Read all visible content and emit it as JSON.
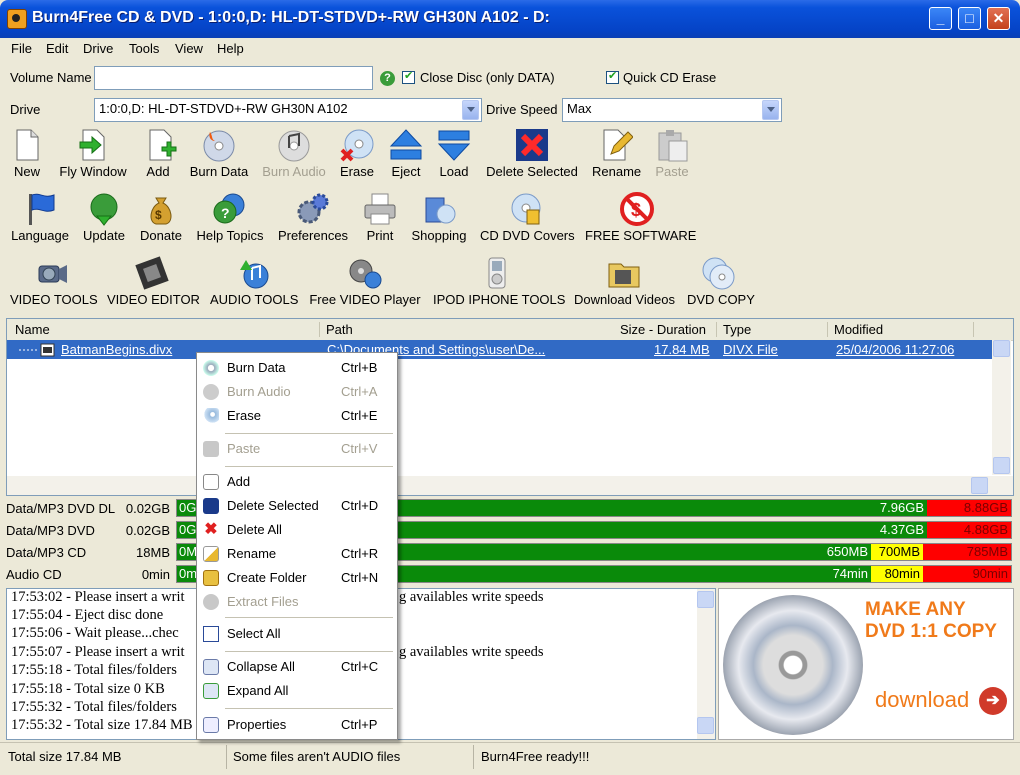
{
  "window": {
    "title": "Burn4Free CD & DVD - 1:0:0,D: HL-DT-STDVD+-RW GH30N   A102 - D:",
    "min": "_",
    "max": "□",
    "close": "✕"
  },
  "menu": [
    "File",
    "Edit",
    "Drive",
    "Tools",
    "View",
    "Help"
  ],
  "form": {
    "volume_label": "Volume Name",
    "volume_value": "",
    "close_disc": "Close Disc (only DATA)",
    "quick_erase": "Quick CD Erase",
    "drive_label": "Drive",
    "drive_value": "1:0:0,D: HL-DT-STDVD+-RW GH30N   A102",
    "speed_label": "Drive Speed",
    "speed_value": "Max"
  },
  "toolbar1": [
    "New",
    "Fly Window",
    "Add",
    "Burn Data",
    "Burn Audio",
    "Erase",
    "Eject",
    "Load",
    "Delete Selected",
    "Rename",
    "Paste"
  ],
  "toolbar2": [
    "Language",
    "Update",
    "Donate",
    "Help Topics",
    "Preferences",
    "Print",
    "Shopping",
    "CD DVD Covers",
    "FREE SOFTWARE"
  ],
  "toolbar3": [
    "VIDEO TOOLS",
    "VIDEO EDITOR",
    "AUDIO TOOLS",
    "Free VIDEO Player",
    "IPOD IPHONE TOOLS",
    "Download Videos",
    "DVD COPY"
  ],
  "list": {
    "headers": [
      "Name",
      "Path",
      "Size - Duration",
      "Type",
      "Modified"
    ],
    "row": {
      "name": "BatmanBegins.divx",
      "path": "C:\\Documents and Settings\\user\\De...",
      "size": "17.84 MB",
      "type": "DIVX File",
      "modified": "25/04/2006 11:27:06"
    }
  },
  "capacity": [
    {
      "name": "Data/MP3 DVD DL",
      "size": "0.02GB",
      "start": "0G",
      "mid": "",
      "good": "7.96GB",
      "max": "8.88GB"
    },
    {
      "name": "Data/MP3 DVD",
      "size": "0.02GB",
      "start": "0G",
      "mid": "",
      "good": "4.37GB",
      "max": "4.88GB"
    },
    {
      "name": "Data/MP3 CD",
      "size": "18MB",
      "start": "0M",
      "good": "650MB",
      "mid": "700MB",
      "max": "785MB"
    },
    {
      "name": "Audio CD",
      "size": "0min",
      "start": "0m",
      "good": "74min",
      "mid": "80min",
      "max": "90min"
    }
  ],
  "log": [
    "17:53:02 - Please insert a writ",
    "17:55:04 - Eject disc done",
    "17:55:06 - Wait please...chec",
    "17:55:07 - Please insert a writ",
    "17:55:18 - Total files/folders",
    "17:55:18 - Total size 0 KB",
    "17:55:32 - Total files/folders",
    "17:55:32 - Total size 17.84 MB"
  ],
  "log_right": [
    "g availables write speeds",
    "g availables write speeds"
  ],
  "ad": {
    "line1": "MAKE ANY",
    "line2": "DVD 1:1 COPY",
    "link": "download"
  },
  "status": [
    "Total size 17.84 MB",
    "Some files aren't AUDIO files",
    "Burn4Free ready!!!"
  ],
  "context_menu": [
    {
      "label": "Burn Data",
      "shortcut": "Ctrl+B"
    },
    {
      "label": "Burn Audio",
      "shortcut": "Ctrl+A"
    },
    {
      "label": "Erase",
      "shortcut": "Ctrl+E"
    },
    {
      "label": "Paste",
      "shortcut": "Ctrl+V"
    },
    {
      "label": "Add",
      "shortcut": ""
    },
    {
      "label": "Delete Selected",
      "shortcut": "Ctrl+D"
    },
    {
      "label": "Delete All",
      "shortcut": ""
    },
    {
      "label": "Rename",
      "shortcut": "Ctrl+R"
    },
    {
      "label": "Create Folder",
      "shortcut": "Ctrl+N"
    },
    {
      "label": "Extract Files",
      "shortcut": ""
    },
    {
      "label": "Select All",
      "shortcut": ""
    },
    {
      "label": "Collapse All",
      "shortcut": "Ctrl+C"
    },
    {
      "label": "Expand All",
      "shortcut": ""
    },
    {
      "label": "Properties",
      "shortcut": "Ctrl+P"
    }
  ],
  "colors": {
    "titlebar": "#0543c6",
    "selection": "#316ac5",
    "good": "#0a8a0a",
    "warn": "#ffff00",
    "over": "#ff0000",
    "ad_orange": "#f07a1a"
  }
}
